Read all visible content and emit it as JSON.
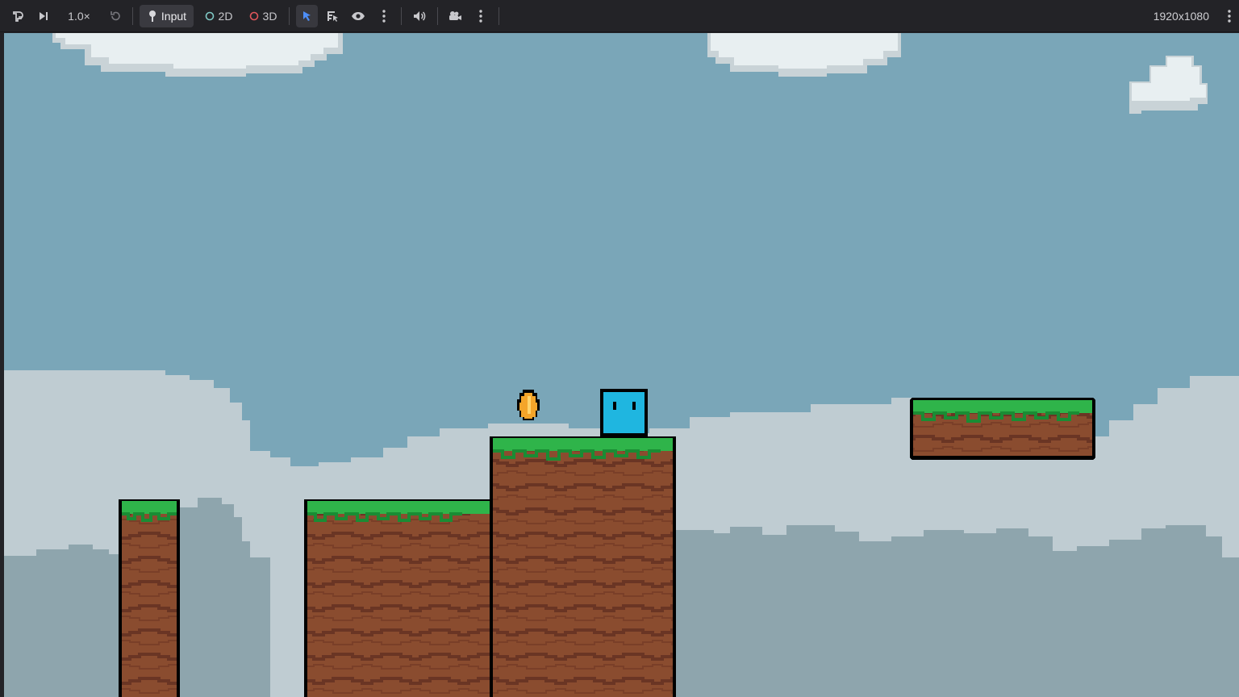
{
  "toolbar": {
    "speed_label": "1.0×",
    "input_label": "Input",
    "mode_2d_label": "2D",
    "mode_3d_label": "3D",
    "resolution": "1920x1080",
    "colors": {
      "accent_blue": "#4d8ef7",
      "mode_2d_ring": "#7fc9c5",
      "mode_3d_ring": "#e0565b"
    }
  },
  "game": {
    "palette": {
      "sky": "#7aa6b8",
      "far_cloud": "#bfccd2",
      "near_hill": "#8ea5ad",
      "cloud": "#e8eff1",
      "cloud_shade": "#c9d3d7",
      "dirt": "#8a4c2f",
      "dirt_stripe": "#6a3524",
      "grass": "#2fb44a",
      "grass_dark": "#1a8c34",
      "player": "#1fb6e0",
      "coin": "#f4a52a"
    }
  }
}
